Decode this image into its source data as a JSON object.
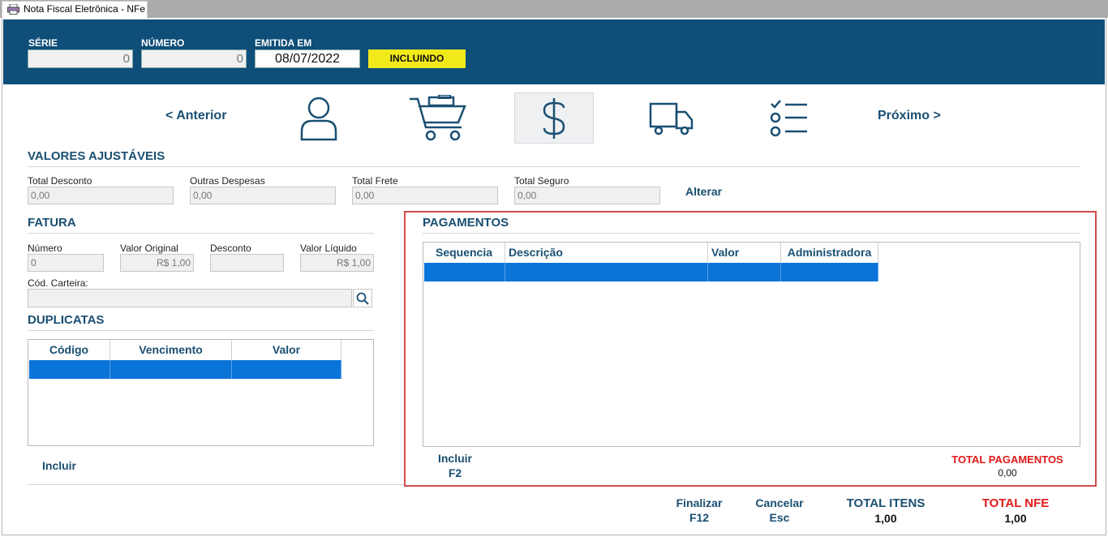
{
  "window": {
    "tab_title": "Nota Fiscal Eletrônica - NFe",
    "tab_icon": "printer-icon"
  },
  "header": {
    "serie_label": "SÉRIE",
    "serie_value": "0",
    "numero_label": "NÚMERO",
    "numero_value": "0",
    "emitida_label": "EMITIDA EM",
    "emitida_value": "08/07/2022",
    "status": "INCLUINDO",
    "status_color": "#f2e91b",
    "header_color": "#0e4e78"
  },
  "steps": {
    "prev_label": "< Anterior",
    "next_label": "Próximo >",
    "icons": [
      "user-icon",
      "cart-icon",
      "dollar-icon",
      "truck-icon",
      "checklist-icon"
    ],
    "active_icon": "dollar-icon"
  },
  "valores": {
    "title": "VALORES AJUSTÁVEIS",
    "total_desconto_label": "Total Desconto",
    "total_desconto_value": "0,00",
    "outras_despesas_label": "Outras Despesas",
    "outras_despesas_value": "0,00",
    "total_frete_label": "Total Frete",
    "total_frete_value": "0,00",
    "total_seguro_label": "Total Seguro",
    "total_seguro_value": "0,00",
    "alterar_label": "Alterar"
  },
  "fatura": {
    "title": "FATURA",
    "numero_label": "Número",
    "numero_value": "0",
    "valor_original_label": "Valor Original",
    "valor_original_value": "R$ 1,00",
    "desconto_label": "Desconto",
    "desconto_value": "",
    "valor_liquido_label": "Valor Líquido",
    "valor_liquido_value": "R$ 1,00",
    "carteira_label": "Cód. Carteira:",
    "carteira_value": ""
  },
  "duplicatas": {
    "title": "DUPLICATAS",
    "columns": [
      "Código",
      "Vencimento",
      "Valor"
    ],
    "incluir_label": "Incluir"
  },
  "pagamentos": {
    "title": "PAGAMENTOS",
    "columns": [
      "Sequencia",
      "Descrição",
      "Valor",
      "Administradora"
    ],
    "incluir_label": "Incluir",
    "incluir_shortcut": "F2",
    "total_label": "TOTAL PAGAMENTOS",
    "total_value": "0,00"
  },
  "footer": {
    "finalizar_label": "Finalizar",
    "finalizar_shortcut": "F12",
    "cancelar_label": "Cancelar",
    "cancelar_shortcut": "Esc",
    "total_itens_label": "TOTAL ITENS",
    "total_itens_value": "1,00",
    "total_nfe_label": "TOTAL NFE",
    "total_nfe_value": "1,00",
    "accent_red": "#e01919",
    "accent_blue": "#1a4f72"
  },
  "selection_color": "#0a74d8"
}
